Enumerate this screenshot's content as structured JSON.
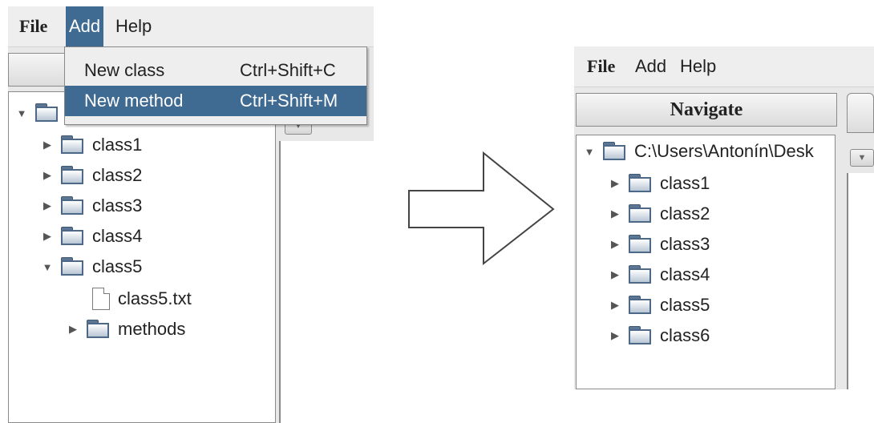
{
  "before": {
    "menu": {
      "file": "File",
      "add": "Add",
      "help": "Help"
    },
    "add_menu_items": [
      {
        "label": "New class",
        "shortcut": "Ctrl+Shift+C"
      },
      {
        "label": "New method",
        "shortcut": "Ctrl+Shift+M"
      }
    ],
    "tree_items": [
      {
        "label": "class1"
      },
      {
        "label": "class2"
      },
      {
        "label": "class3"
      },
      {
        "label": "class4"
      },
      {
        "label": "class5"
      },
      {
        "label": "class5.txt"
      },
      {
        "label": "methods"
      }
    ]
  },
  "after": {
    "menu": {
      "file": "File",
      "add": "Add",
      "help": "Help"
    },
    "navigate_label": "Navigate",
    "root_label": "C:\\Users\\Antonín\\Desk",
    "tree_items": [
      {
        "label": "class1"
      },
      {
        "label": "class2"
      },
      {
        "label": "class3"
      },
      {
        "label": "class4"
      },
      {
        "label": "class5"
      },
      {
        "label": "class6"
      }
    ]
  },
  "colors": {
    "menu_highlight": "#3f6a91",
    "arrow_stroke": "#444444"
  },
  "icons": [
    "folder-icon",
    "file-icon",
    "expand-arrow-icon",
    "collapse-arrow-icon",
    "right-arrow-icon"
  ]
}
